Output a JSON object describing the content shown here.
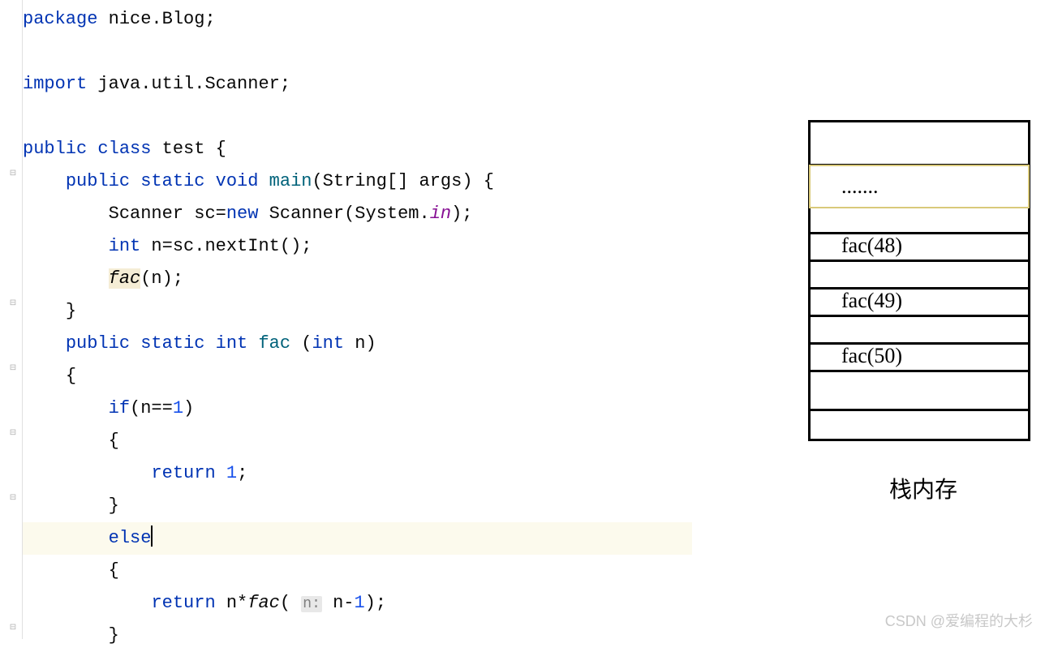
{
  "code": {
    "line1": {
      "kw1": "package",
      "txt": " nice.Blog;"
    },
    "line2": {
      "kw1": "import",
      "txt": " java.util.Scanner;"
    },
    "line3": {
      "kw1": "public",
      "kw2": "class",
      "txt1": " ",
      "txt2": " test {"
    },
    "line4": {
      "indent": "    ",
      "kw1": "public",
      "kw2": "static",
      "kw3": "void",
      "fn": "main",
      "txt": "(String[] args) {"
    },
    "line5": {
      "indent": "        ",
      "txt1": "Scanner sc=",
      "kw1": "new",
      "txt2": " Scanner(System.",
      "fld": "in",
      "txt3": ");"
    },
    "line6": {
      "indent": "        ",
      "kw1": "int",
      "txt": " n=sc.nextInt();"
    },
    "line7": {
      "indent": "        ",
      "fn": "fac",
      "txt": "(n);"
    },
    "line8": {
      "indent": "    ",
      "txt": "}"
    },
    "line9": {
      "indent": "    ",
      "kw1": "public",
      "kw2": "static",
      "kw3": "int",
      "fn": "fac",
      "txt": " (",
      "kw4": "int",
      "txt2": " n)"
    },
    "line10": {
      "indent": "    ",
      "txt": "{"
    },
    "line11": {
      "indent": "        ",
      "kw1": "if",
      "txt1": "(n==",
      "num": "1",
      "txt2": ")"
    },
    "line12": {
      "indent": "        ",
      "txt": "{"
    },
    "line13": {
      "indent": "            ",
      "kw1": "return",
      "txt": " ",
      "num": "1",
      "txt2": ";"
    },
    "line14": {
      "indent": "        ",
      "txt": "}"
    },
    "line15": {
      "indent": "        ",
      "kw1": "else"
    },
    "line16": {
      "indent": "        ",
      "txt": "{"
    },
    "line17": {
      "indent": "            ",
      "kw1": "return",
      "txt1": " n*",
      "fn": "fac",
      "txt2": "( ",
      "hint": "n:",
      "txt3": " n-",
      "num": "1",
      "txt4": ");"
    },
    "line18": {
      "indent": "        ",
      "txt": "}"
    }
  },
  "stack": {
    "dots": ".......",
    "cell1": "fac(48)",
    "cell2": "fac(49)",
    "cell3": "fac(50)",
    "label": "栈内存"
  },
  "watermark": "CSDN @爱编程的大杉"
}
